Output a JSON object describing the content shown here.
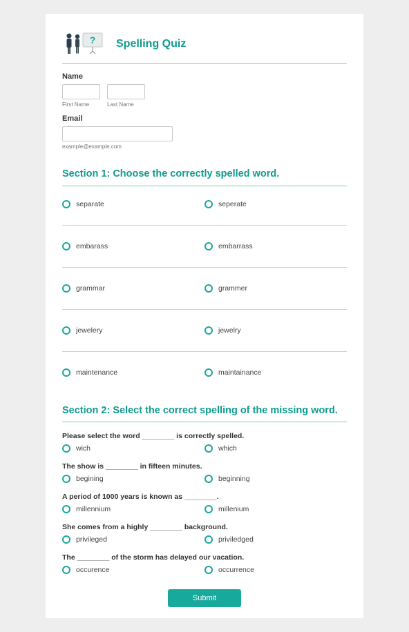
{
  "header": {
    "title": "Spelling Quiz"
  },
  "name": {
    "label": "Name",
    "first_sublabel": "First Name",
    "last_sublabel": "Last Name"
  },
  "email": {
    "label": "Email",
    "hint": "example@example.com"
  },
  "section1": {
    "heading": "Section 1: Choose the correctly spelled word.",
    "questions": [
      {
        "a": "separate",
        "b": "seperate"
      },
      {
        "a": "embarass",
        "b": "embarrass"
      },
      {
        "a": "grammar",
        "b": "grammer"
      },
      {
        "a": "jewelery",
        "b": "jewelry"
      },
      {
        "a": "maintenance",
        "b": "maintainance"
      }
    ]
  },
  "section2": {
    "heading": "Section 2: Select the correct spelling of the missing word.",
    "questions": [
      {
        "prompt": "Please select the word ________ is correctly spelled.",
        "a": "wich",
        "b": "which"
      },
      {
        "prompt": "The show is ________ in fifteen minutes.",
        "a": "begining",
        "b": "beginning"
      },
      {
        "prompt": "A period of 1000 years is known as ________.",
        "a": "millennium",
        "b": "millenium"
      },
      {
        "prompt": "She comes from a highly ________ background.",
        "a": "privileged",
        "b": "priviledged"
      },
      {
        "prompt": "The ________ of the storm has delayed our vacation.",
        "a": "occurence",
        "b": "occurrence"
      }
    ]
  },
  "submit": {
    "label": "Submit"
  }
}
